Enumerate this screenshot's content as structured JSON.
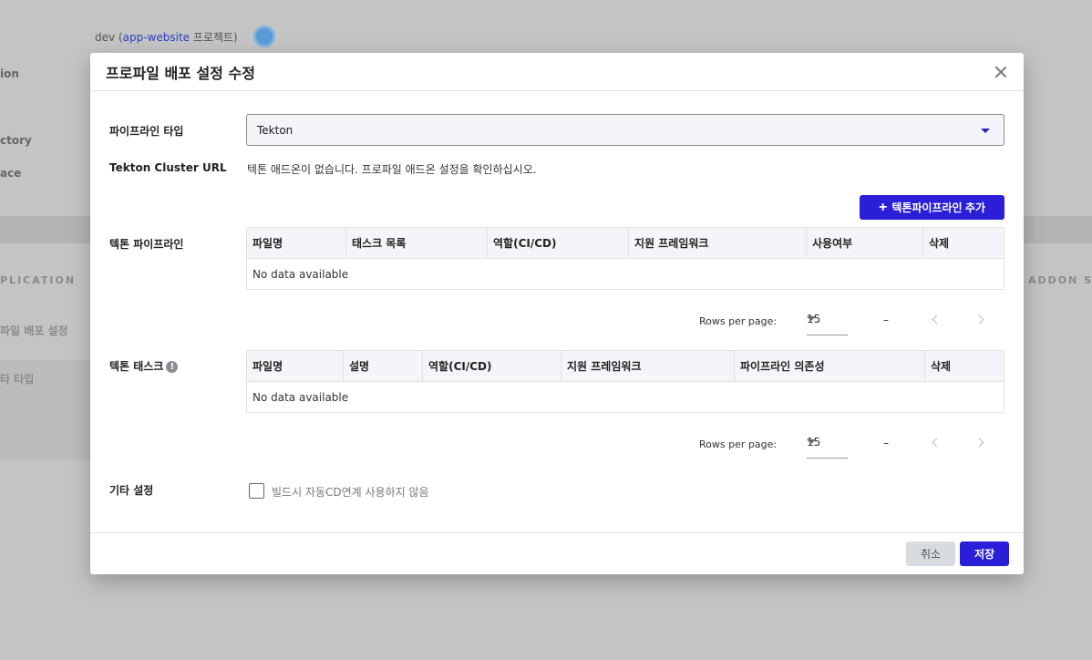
{
  "background": {
    "breadcrumb_prefix": "dev",
    "breadcrumb_link": "app-website",
    "breadcrumb_suffix": "프로젝트",
    "side_items": [
      "ion",
      "ctory",
      "ace"
    ],
    "section_left": "PLICATION",
    "section_right": "ADDON SET",
    "sub_left": "파일 배포 설정",
    "sub_left2": "타 타입"
  },
  "modal": {
    "title": "프로파일 배포 설정 수정",
    "pipeline_type": {
      "label": "파이프라인 타입",
      "value": "Tekton"
    },
    "cluster_url": {
      "label": "Tekton Cluster URL",
      "message": "텍톤 애드온이 없습니다. 프로파일 애드온 설정을 확인하십시오."
    },
    "add_pipeline_button": "텍톤파이프라인 추가",
    "pipeline_section": {
      "label": "텍톤 파이프라인",
      "columns": [
        "파일명",
        "태스크 목록",
        "역할(CI/CD)",
        "지원 프레임워크",
        "사용여부",
        "삭제"
      ],
      "empty_text": "No data available",
      "pagination": {
        "rows_per_page_label": "Rows per page:",
        "rows_per_page_value": "15",
        "range": "–"
      }
    },
    "task_section": {
      "label": "텍톤 태스크",
      "info_icon": "!",
      "columns": [
        "파일명",
        "설명",
        "역할(CI/CD)",
        "지원 프레임워크",
        "파이프라인 의존성",
        "삭제"
      ],
      "empty_text": "No data available",
      "pagination": {
        "rows_per_page_label": "Rows per page:",
        "rows_per_page_value": "15",
        "range": "–"
      }
    },
    "other_settings": {
      "label": "기타 설정",
      "checkbox_label": "빌드시 자동CD연계 사용하지 않음",
      "checked": false
    },
    "footer": {
      "cancel_label": "취소",
      "save_label": "저장"
    }
  }
}
